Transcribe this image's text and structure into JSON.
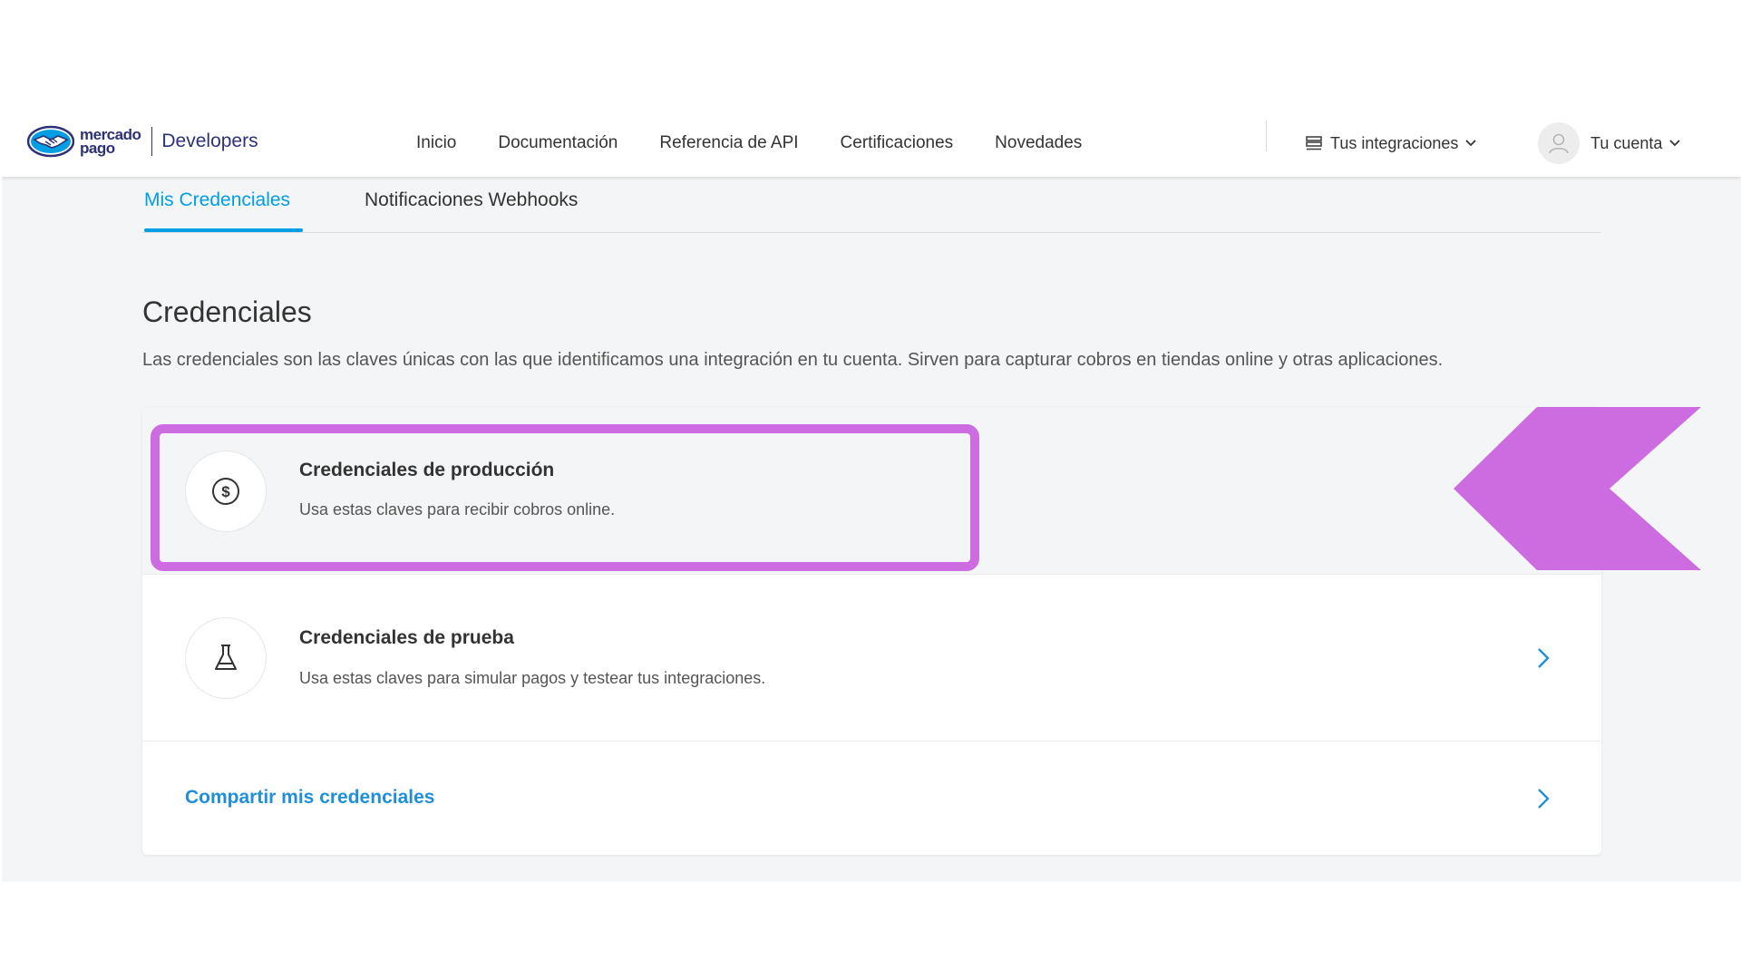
{
  "header": {
    "logo_line1": "mercado",
    "logo_line2": "pago",
    "logo_product": "Developers",
    "nav": [
      "Inicio",
      "Documentación",
      "Referencia de API",
      "Certificaciones",
      "Novedades"
    ],
    "integrations_label": "Tus integraciones",
    "account_label": "Tu cuenta"
  },
  "tabs": {
    "active": "Mis Credenciales",
    "other": "Notificaciones Webhooks"
  },
  "main": {
    "title": "Credenciales",
    "description": "Las credenciales son las claves únicas con las que identificamos una integración en tu cuenta. Sirven para capturar cobros en tiendas online y otras aplicaciones."
  },
  "credentials": {
    "production": {
      "title": "Credenciales de producción",
      "subtitle": "Usa estas claves para recibir cobros online."
    },
    "test": {
      "title": "Credenciales de prueba",
      "subtitle": "Usa estas claves para simular pagos y testear tus integraciones."
    },
    "share_label": "Compartir mis credenciales"
  },
  "icons": {
    "production": "dollar-circle-icon",
    "test": "flask-icon",
    "chevron": "chevron-right-icon"
  },
  "colors": {
    "accent": "#009ee3",
    "link": "#1f8fd8",
    "brand": "#2d3277",
    "annotation": "#cc6ce0"
  }
}
